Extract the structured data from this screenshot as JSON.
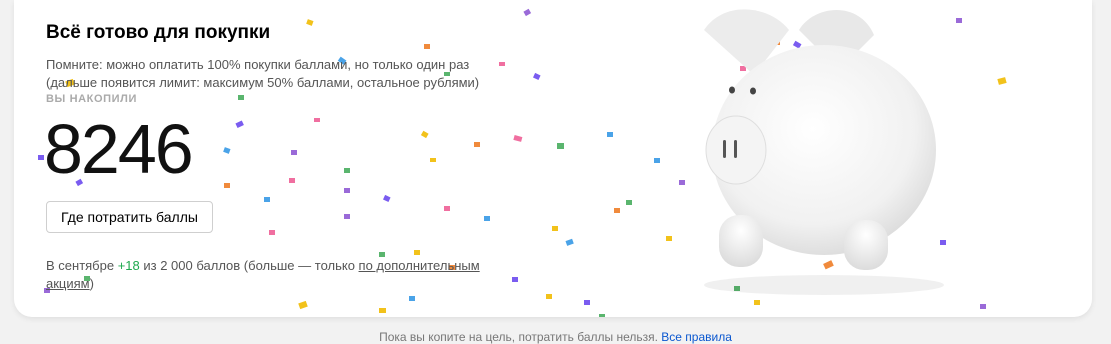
{
  "promo": {
    "title": "Всё готово для покупки",
    "description": "Помните: можно оплатить 100% покупки баллами, но только один раз (дальше появится лимит: максимум 50% баллами, остальное рублями)",
    "accumulated_label": "ВЫ НАКОПИЛИ",
    "accumulated_value": "8246",
    "spend_button_label": "Где потратить баллы",
    "monthly": {
      "prefix": "В сентябре ",
      "earned": "+18",
      "middle": " из 2 000 баллов (больше — только ",
      "link": "по дополнительным акциям",
      "suffix": ")"
    }
  },
  "footer": {
    "text": "Пока вы копите на цель, потратить баллы нельзя. ",
    "link": "Все правила"
  },
  "colors": {
    "accent_green": "#1ea94e",
    "link_blue": "#0a57d0",
    "confetti": [
      "#7a5cf0",
      "#f2c21b",
      "#4aa3e8",
      "#f08a3c",
      "#5ab56e",
      "#f06fa0",
      "#9a6ad8"
    ]
  },
  "icons": {
    "illustration": "piggy-bank",
    "decoration": "confetti"
  }
}
